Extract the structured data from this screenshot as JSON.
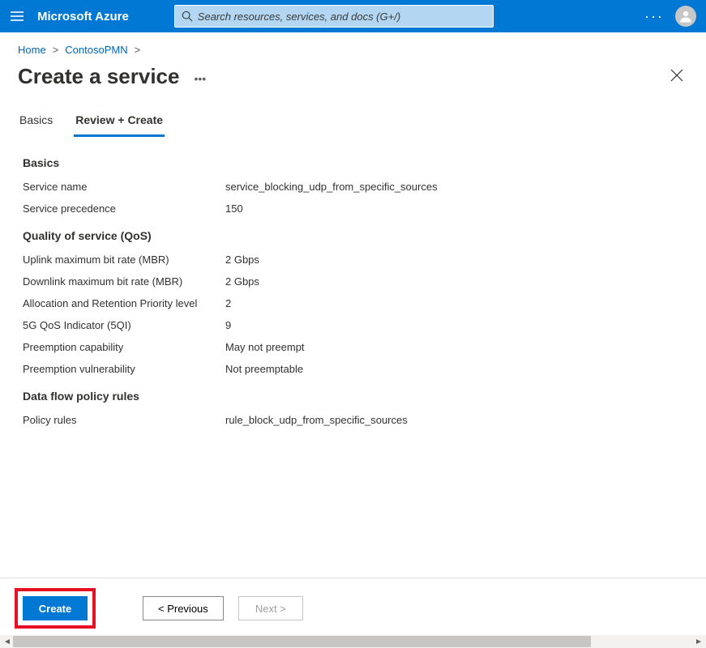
{
  "header": {
    "brand": "Microsoft Azure",
    "search_placeholder": "Search resources, services, and docs (G+/)"
  },
  "breadcrumb": {
    "home": "Home",
    "resource": "ContosoPMN"
  },
  "page": {
    "title": "Create a service"
  },
  "tabs": {
    "basics": "Basics",
    "review": "Review + Create"
  },
  "sections": {
    "basics": {
      "heading": "Basics",
      "rows": {
        "service_name": {
          "label": "Service name",
          "value": "service_blocking_udp_from_specific_sources"
        },
        "service_precedence": {
          "label": "Service precedence",
          "value": "150"
        }
      }
    },
    "qos": {
      "heading": "Quality of service (QoS)",
      "rows": {
        "uplink_mbr": {
          "label": "Uplink maximum bit rate (MBR)",
          "value": "2 Gbps"
        },
        "downlink_mbr": {
          "label": "Downlink maximum bit rate (MBR)",
          "value": "2 Gbps"
        },
        "arp_level": {
          "label": "Allocation and Retention Priority level",
          "value": "2"
        },
        "five_qi": {
          "label": "5G QoS Indicator (5QI)",
          "value": "9"
        },
        "preempt_cap": {
          "label": "Preemption capability",
          "value": "May not preempt"
        },
        "preempt_vuln": {
          "label": "Preemption vulnerability",
          "value": "Not preemptable"
        }
      }
    },
    "policy": {
      "heading": "Data flow policy rules",
      "rows": {
        "policy_rules": {
          "label": "Policy rules",
          "value": "rule_block_udp_from_specific_sources"
        }
      }
    }
  },
  "footer": {
    "create": "Create",
    "previous": "<  Previous",
    "next": "Next  >"
  }
}
